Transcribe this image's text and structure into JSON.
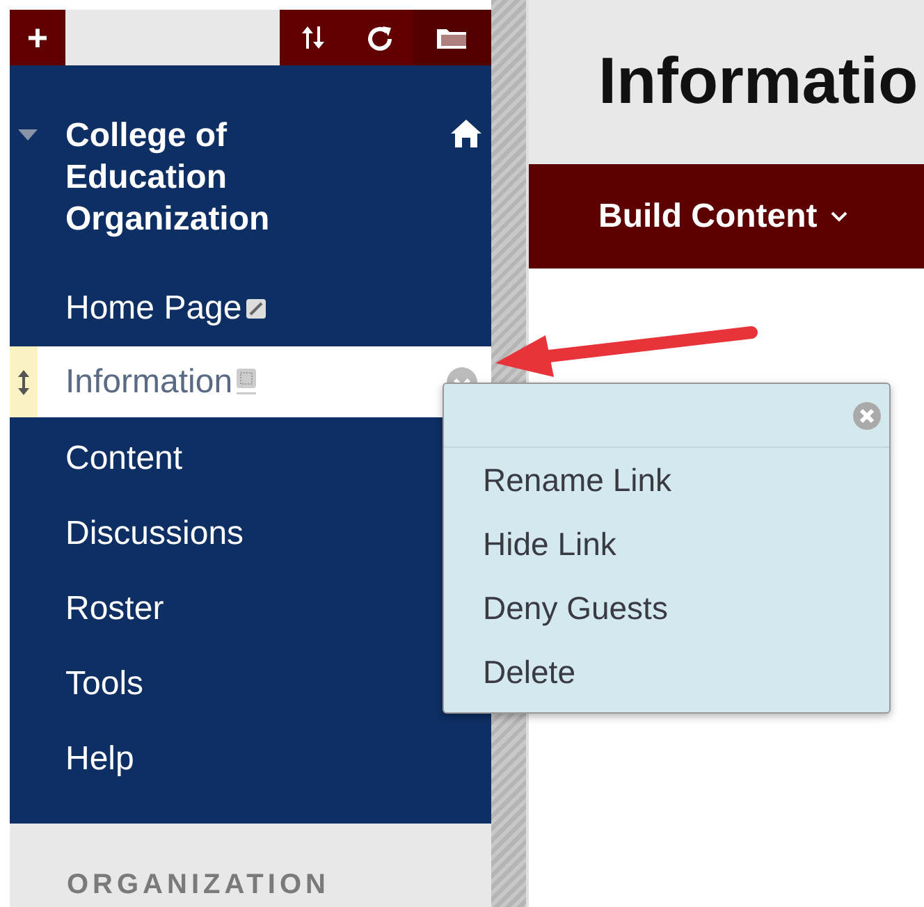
{
  "toolbar": {
    "add_button": "+"
  },
  "course": {
    "title": "College of Education Organization",
    "expanded": true
  },
  "menu": [
    {
      "label": "Home Page",
      "kind": "page",
      "selected": false
    },
    {
      "label": "Information",
      "kind": "blank",
      "selected": true
    },
    {
      "label": "Content",
      "kind": "link",
      "selected": false
    },
    {
      "label": "Discussions",
      "kind": "link",
      "selected": false
    },
    {
      "label": "Roster",
      "kind": "link",
      "selected": false
    },
    {
      "label": "Tools",
      "kind": "link",
      "selected": false
    },
    {
      "label": "Help",
      "kind": "link",
      "selected": false
    }
  ],
  "management": {
    "heading": "ORGANIZATION"
  },
  "page": {
    "title": "Informatio",
    "action_menu": "Build Content"
  },
  "context_menu": {
    "items": [
      "Rename Link",
      "Hide Link",
      "Deny Guests",
      "Delete"
    ]
  }
}
